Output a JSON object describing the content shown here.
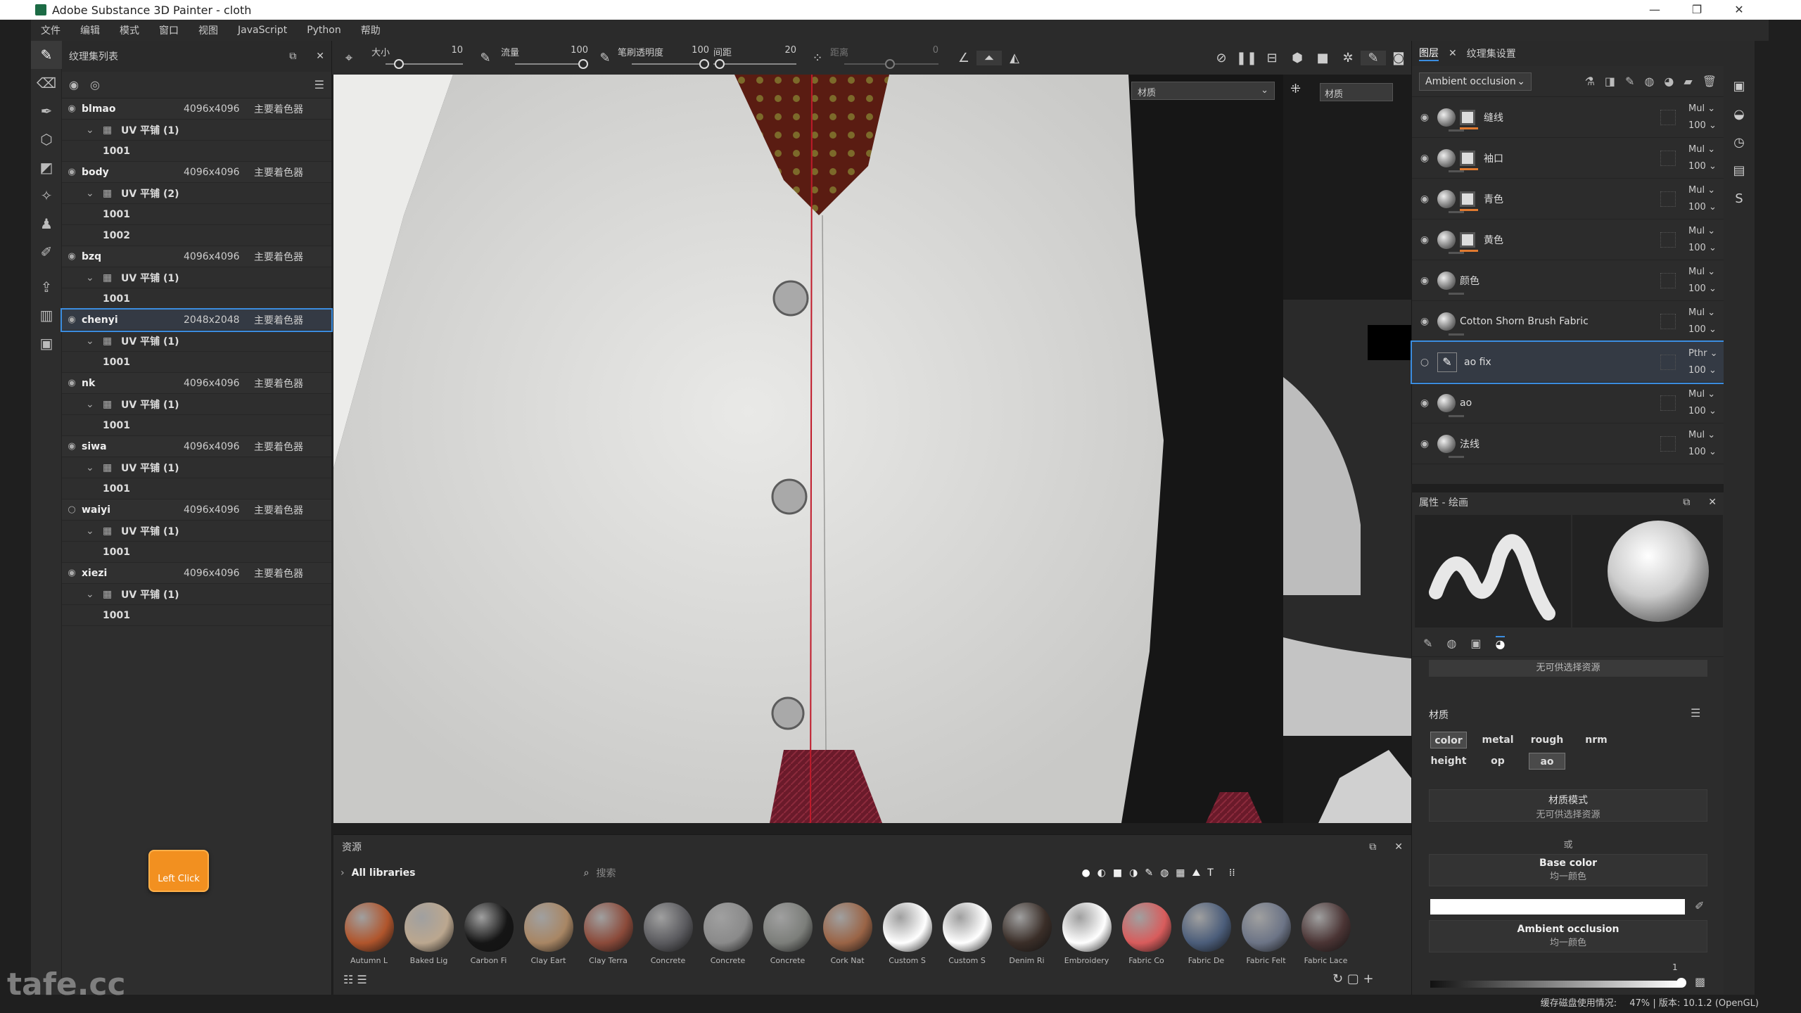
{
  "window": {
    "title": "Adobe Substance 3D Painter - cloth",
    "min": "—",
    "max": "❐",
    "close": "✕"
  },
  "menu": [
    "文件",
    "编辑",
    "模式",
    "窗口",
    "视图",
    "JavaScript",
    "Python",
    "帮助"
  ],
  "texture_set_panel": {
    "title": "纹理集列表",
    "sets": [
      {
        "name": "blmao",
        "res": "4096x4096",
        "shader": "主要着色器",
        "uv": "UV 平铺 (1)",
        "tiles": [
          "1001"
        ],
        "visible": true
      },
      {
        "name": "body",
        "res": "4096x4096",
        "shader": "主要着色器",
        "uv": "UV 平铺 (2)",
        "tiles": [
          "1001",
          "1002"
        ],
        "visible": true
      },
      {
        "name": "bzq",
        "res": "4096x4096",
        "shader": "主要着色器",
        "uv": "UV 平铺 (1)",
        "tiles": [
          "1001"
        ],
        "visible": true
      },
      {
        "name": "chenyi",
        "res": "2048x2048",
        "shader": "主要着色器",
        "uv": "UV 平铺 (1)",
        "tiles": [
          "1001"
        ],
        "visible": true,
        "selected": true
      },
      {
        "name": "nk",
        "res": "4096x4096",
        "shader": "主要着色器",
        "uv": "UV 平铺 (1)",
        "tiles": [
          "1001"
        ],
        "visible": true
      },
      {
        "name": "siwa",
        "res": "4096x4096",
        "shader": "主要着色器",
        "uv": "UV 平铺 (1)",
        "tiles": [
          "1001"
        ],
        "visible": true
      },
      {
        "name": "waiyi",
        "res": "4096x4096",
        "shader": "主要着色器",
        "uv": "UV 平铺 (1)",
        "tiles": [
          "1001"
        ],
        "visible": false
      },
      {
        "name": "xiezi",
        "res": "4096x4096",
        "shader": "主要着色器",
        "uv": "UV 平铺 (1)",
        "tiles": [
          "1001"
        ],
        "visible": true
      }
    ]
  },
  "toolbar": {
    "size_label": "大小",
    "size_value": "10",
    "flow_label": "流量",
    "flow_value": "100",
    "opacity_label": "笔刷透明度",
    "opacity_value": "100",
    "spacing_label": "间距",
    "spacing_value": "20",
    "distance_label": "距离",
    "distance_value": "0"
  },
  "viewport": {
    "material_dropdown": "材质",
    "right_material": "材质"
  },
  "layers_panel": {
    "tab_layers": "图层",
    "tab_settings": "纹理集设置",
    "channel_dropdown": "Ambient occlusion",
    "layers": [
      {
        "name": "缝线",
        "blend": "Mul",
        "opacity": "100",
        "mask": true
      },
      {
        "name": "袖口",
        "blend": "Mul",
        "opacity": "100",
        "mask": true
      },
      {
        "name": "青色",
        "blend": "Mul",
        "opacity": "100",
        "mask": true
      },
      {
        "name": "黄色",
        "blend": "Mul",
        "opacity": "100",
        "mask": true
      },
      {
        "name": "颜色",
        "blend": "Mul",
        "opacity": "100",
        "mask": false
      },
      {
        "name": "Cotton Shorn Brush Fabric",
        "blend": "Mul",
        "opacity": "100",
        "mask": false
      },
      {
        "name": "ao fix",
        "blend": "Pthr",
        "opacity": "100",
        "mask": false,
        "paint": true,
        "selected": true
      },
      {
        "name": "ao",
        "blend": "Mul",
        "opacity": "100",
        "mask": false
      },
      {
        "name": "法线",
        "blend": "Mul",
        "opacity": "100",
        "mask": false
      }
    ]
  },
  "properties_panel": {
    "title": "属性 - 绘画",
    "no_resource": "无可供选择资源",
    "material_title": "材质",
    "channels": [
      {
        "label": "color",
        "on": true
      },
      {
        "label": "metal",
        "on": false
      },
      {
        "label": "rough",
        "on": false
      },
      {
        "label": "nrm",
        "on": false
      },
      {
        "label": "height",
        "on": false
      },
      {
        "label": "op",
        "on": false
      },
      {
        "label": "ao",
        "on": true
      }
    ],
    "material_mode": "材质模式",
    "material_mode_value": "无可供选择资源",
    "or": "或",
    "base_color": "Base color",
    "base_color_sub": "均一颜色",
    "ao_title": "Ambient occlusion",
    "ao_sub": "均一颜色",
    "ao_value": "1"
  },
  "assets_panel": {
    "title": "资源",
    "library": "All libraries",
    "search_placeholder": "搜索",
    "items": [
      {
        "name": "Autumn L",
        "color": "#b0552c"
      },
      {
        "name": "Baked Lig",
        "color": "#bba78f"
      },
      {
        "name": "Carbon Fi",
        "color": "#151515"
      },
      {
        "name": "Clay Eart",
        "color": "#a88664"
      },
      {
        "name": "Clay Terra",
        "color": "#8b4a3a"
      },
      {
        "name": "Concrete",
        "color": "#5a5a5e"
      },
      {
        "name": "Concrete",
        "color": "#8a8a8a"
      },
      {
        "name": "Concrete",
        "color": "#7c7e7a"
      },
      {
        "name": "Cork Nat",
        "color": "#9a6446"
      },
      {
        "name": "Custom S",
        "color": "#ffffff"
      },
      {
        "name": "Custom S",
        "color": "#ffffff"
      },
      {
        "name": "Denim Ri",
        "color": "#3a2e28"
      },
      {
        "name": "Embroidery",
        "color": "#ffffff"
      },
      {
        "name": "Fabric Co",
        "color": "#d85c5c"
      },
      {
        "name": "Fabric De",
        "color": "#4b5d7a"
      },
      {
        "name": "Fabric Felt",
        "color": "#6c7486"
      },
      {
        "name": "Fabric Lace",
        "color": "#4a3434"
      }
    ]
  },
  "status": {
    "text": "缓存磁盘使用情况:",
    "zoom": "47%",
    "version": "| 版本: 10.1.2 (OpenGL)"
  },
  "overlay": {
    "click_label": "Left Click",
    "watermark": "tafe.cc"
  }
}
